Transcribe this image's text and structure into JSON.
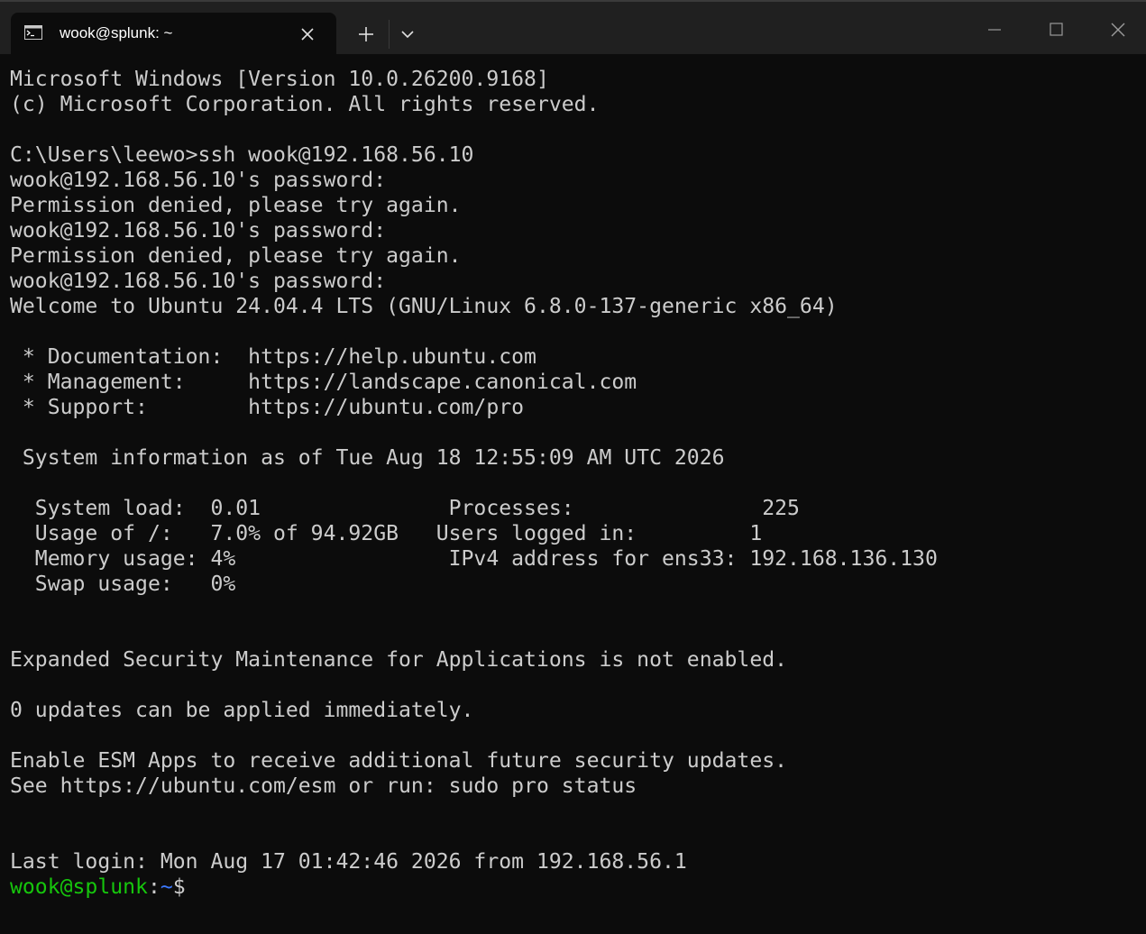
{
  "window": {
    "tab_title": "wook@splunk: ~"
  },
  "terminal": {
    "lines": [
      "Microsoft Windows [Version 10.0.26200.9168]",
      "(c) Microsoft Corporation. All rights reserved.",
      "",
      "C:\\Users\\leewo>ssh wook@192.168.56.10",
      "wook@192.168.56.10's password:",
      "Permission denied, please try again.",
      "wook@192.168.56.10's password:",
      "Permission denied, please try again.",
      "wook@192.168.56.10's password:",
      "Welcome to Ubuntu 24.04.4 LTS (GNU/Linux 6.8.0-137-generic x86_64)",
      "",
      " * Documentation:  https://help.ubuntu.com",
      " * Management:     https://landscape.canonical.com",
      " * Support:        https://ubuntu.com/pro",
      "",
      " System information as of Tue Aug 18 12:55:09 AM UTC 2026",
      "",
      "  System load:  0.01               Processes:               225",
      "  Usage of /:   7.0% of 94.92GB   Users logged in:         1",
      "  Memory usage: 4%                 IPv4 address for ens33: 192.168.136.130",
      "  Swap usage:   0%",
      "",
      "",
      "Expanded Security Maintenance for Applications is not enabled.",
      "",
      "0 updates can be applied immediately.",
      "",
      "Enable ESM Apps to receive additional future security updates.",
      "See https://ubuntu.com/esm or run: sudo pro status",
      "",
      "",
      "Last login: Mon Aug 17 01:42:46 2026 from 192.168.56.1"
    ],
    "prompt": {
      "user_host": "wook@splunk",
      "separator": ":",
      "path": "~",
      "symbol": "$"
    }
  },
  "colors": {
    "background": "#0c0c0c",
    "titlebar": "#202020",
    "text": "#cccccc",
    "prompt_user": "#16c60c",
    "prompt_path": "#3b78ff"
  }
}
